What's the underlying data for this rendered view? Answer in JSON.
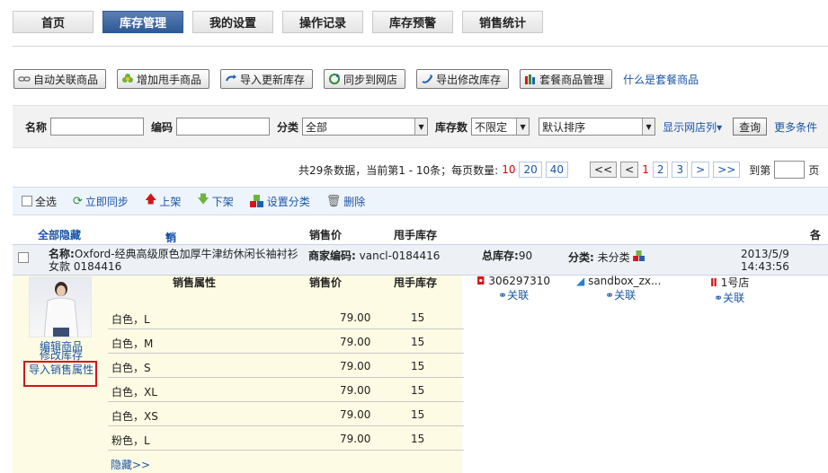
{
  "tabs": [
    "首页",
    "库存管理",
    "我的设置",
    "操作记录",
    "库存预警",
    "销售统计"
  ],
  "active_tab": 1,
  "toolbar": {
    "buttons": [
      "自动关联商品",
      "增加甩手商品",
      "导入更新库存",
      "同步到网店",
      "导出修改库存",
      "套餐商品管理"
    ],
    "help_link": "什么是套餐商品"
  },
  "filter": {
    "name_label": "名称",
    "code_label": "编码",
    "category_label": "分类",
    "category_value": "全部",
    "stock_label": "库存数",
    "stock_value": "不限定",
    "sort_value": "默认排序",
    "show_shop_cols": "显示网店列",
    "query_btn": "查询",
    "more": "更多条件"
  },
  "pager": {
    "summary": "共29条数据，当前第1 - 10条；每页数量:",
    "sizes": [
      "10",
      "20",
      "40"
    ],
    "first": "<<",
    "prev": "<",
    "pages": [
      "1",
      "2",
      "3"
    ],
    "next": ">",
    "last": ">>",
    "goto_label": "到第",
    "page_unit": "页"
  },
  "actions": {
    "select_all": "全选",
    "sync_now": "立即同步",
    "list_up": "上架",
    "list_down": "下架",
    "set_category": "设置分类",
    "delete": "删除"
  },
  "table_head": {
    "hide_all": "全部隐藏",
    "sale_attr": "销售属性",
    "price": "销售价",
    "stock": "甩手库存",
    "shop_cols": "各网"
  },
  "product": {
    "name_label": "名称:",
    "name_line1": "Oxford-经典高级原色加厚牛津纺休闲长袖衬衫",
    "name_line2": "女款 0184416",
    "code_label": "商家编码:",
    "code": "vancl-0184416",
    "total_label": "总库存:",
    "total": "90",
    "cat_label": "分类:",
    "cat": "未分类",
    "date": "2013/5/9",
    "time": "14:43:56"
  },
  "side_links": {
    "edit": "编辑商品",
    "modify_stock": "修改库存",
    "import_attr": "导入销售属性"
  },
  "variants_head": {
    "attr": "销售属性",
    "price": "销售价",
    "stock": "甩手库存"
  },
  "variants": [
    {
      "attr": "白色，L",
      "price": "79.00",
      "stock": "15"
    },
    {
      "attr": "白色，M",
      "price": "79.00",
      "stock": "15"
    },
    {
      "attr": "白色，S",
      "price": "79.00",
      "stock": "15"
    },
    {
      "attr": "白色，XL",
      "price": "79.00",
      "stock": "15"
    },
    {
      "attr": "白色，XS",
      "price": "79.00",
      "stock": "15"
    },
    {
      "attr": "粉色，L",
      "price": "79.00",
      "stock": "15"
    }
  ],
  "hide_link": "隐藏>>",
  "shops": [
    {
      "name": "306297310",
      "link": "关联",
      "color": "#d2161b"
    },
    {
      "name": "sandbox_zx...",
      "link": "关联",
      "color": "#2a7fd0"
    },
    {
      "name": "1号店",
      "link": "关联",
      "color": "#d2161b"
    }
  ]
}
